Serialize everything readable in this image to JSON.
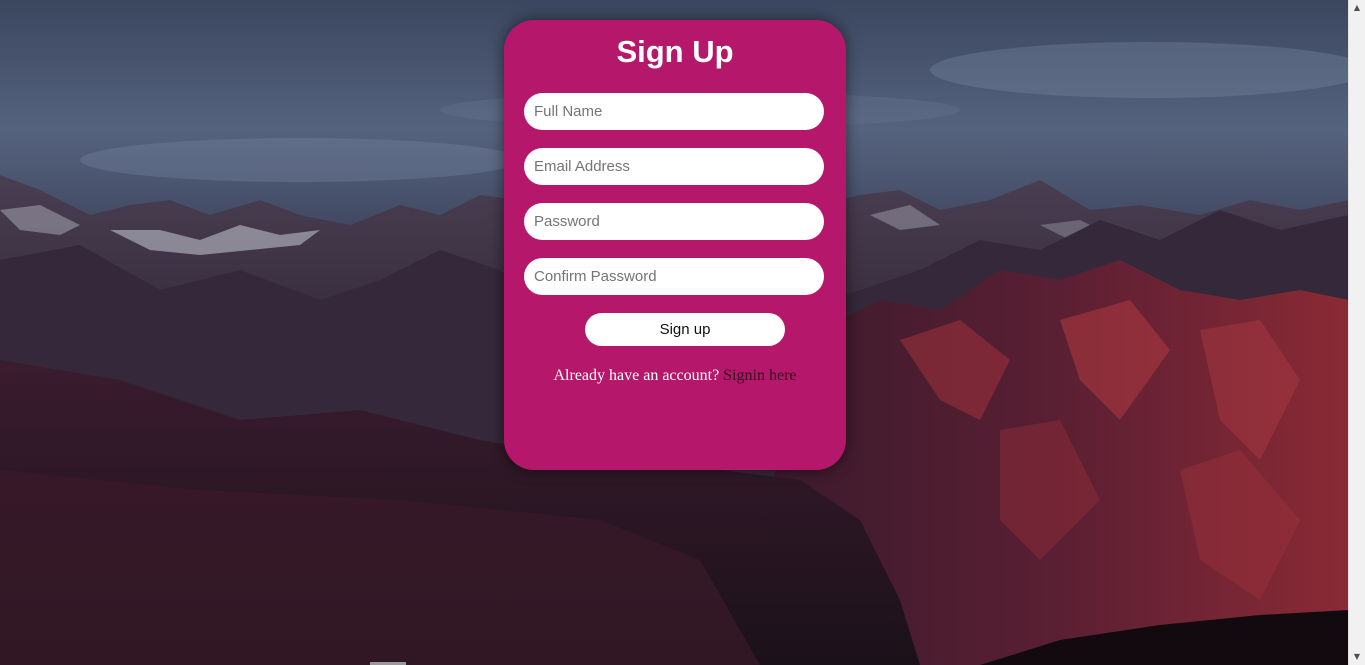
{
  "form": {
    "title": "Sign Up",
    "fields": {
      "full_name": {
        "placeholder": "Full Name",
        "value": ""
      },
      "email": {
        "placeholder": "Email Address",
        "value": ""
      },
      "password": {
        "placeholder": "Password",
        "value": ""
      },
      "confirm_password": {
        "placeholder": "Confirm Password",
        "value": ""
      }
    },
    "submit_label": "Sign up",
    "footer_text": "Already have an account?",
    "signin_link": "Signin here"
  },
  "colors": {
    "card": "#b5186a",
    "link": "#3a0a1e",
    "text": "#ffffff"
  }
}
